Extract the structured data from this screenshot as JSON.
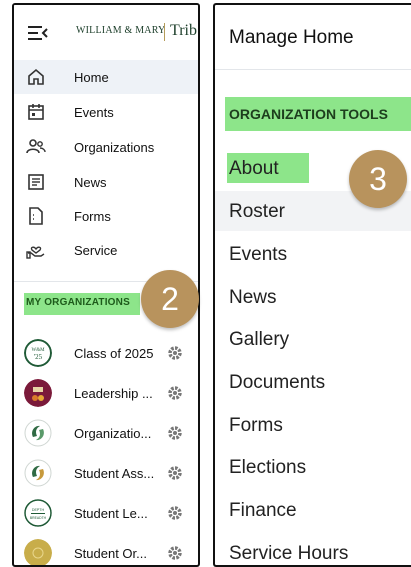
{
  "left_panel": {
    "brand": "WILLIAM & MARY",
    "brand_suffix": "Trib",
    "nav": [
      {
        "label": "Home",
        "icon": "home-icon",
        "active": true
      },
      {
        "label": "Events",
        "icon": "calendar-icon"
      },
      {
        "label": "Organizations",
        "icon": "people-icon"
      },
      {
        "label": "News",
        "icon": "news-icon"
      },
      {
        "label": "Forms",
        "icon": "form-icon"
      },
      {
        "label": "Service",
        "icon": "service-hand-icon"
      }
    ],
    "section_label": "MY ORGANIZATIONS",
    "organizations": [
      {
        "name": "Class of 2025",
        "avatar_text": "W&M '25"
      },
      {
        "name": "Leadership ...",
        "avatar_text": ""
      },
      {
        "name": "Organizatio...",
        "avatar_text": ""
      },
      {
        "name": "Student Ass...",
        "avatar_text": ""
      },
      {
        "name": "Student Le...",
        "avatar_text": "DEPTH BREADTH"
      },
      {
        "name": "Student Or...",
        "avatar_text": ""
      }
    ]
  },
  "right_panel": {
    "title": "Manage Home",
    "section_label": "ORGANIZATION TOOLS",
    "items": [
      "About",
      "Roster",
      "Events",
      "News",
      "Gallery",
      "Documents",
      "Forms",
      "Elections",
      "Finance",
      "Service Hours"
    ]
  },
  "badges": {
    "left": "2",
    "right": "3"
  },
  "colors": {
    "highlight": "#8de58a",
    "badge": "#b8935d",
    "active_bg": "#eef2f7",
    "brand_green": "#1c3e2a"
  }
}
